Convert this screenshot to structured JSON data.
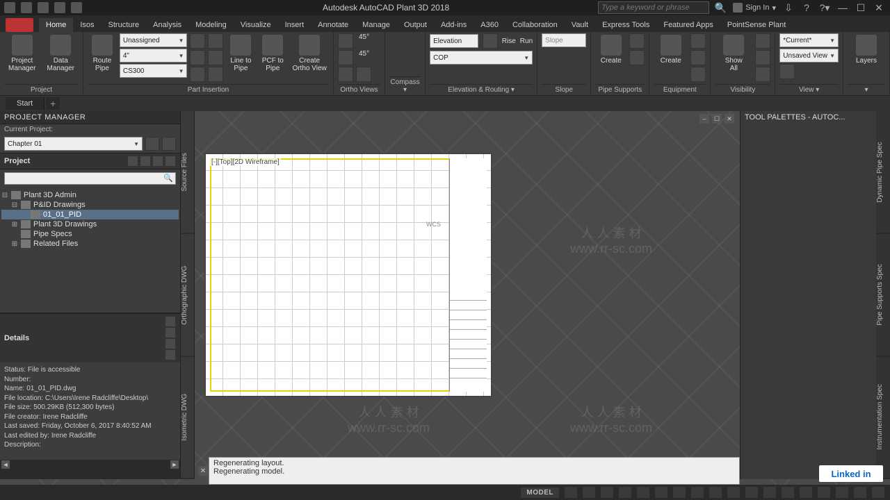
{
  "watermark": {
    "line1": "人 人 素 材",
    "line2": "www.rr-sc.com"
  },
  "titlebar": {
    "app_title": "Autodesk AutoCAD Plant 3D 2018",
    "search_placeholder": "Type a keyword or phrase",
    "sign_in": "Sign In"
  },
  "menu": {
    "tabs": [
      "Home",
      "Isos",
      "Structure",
      "Analysis",
      "Modeling",
      "Visualize",
      "Insert",
      "Annotate",
      "Manage",
      "Output",
      "Add-ins",
      "A360",
      "Collaboration",
      "Vault",
      "Express Tools",
      "Featured Apps",
      "PointSense Plant"
    ]
  },
  "ribbon": {
    "project": {
      "label": "Project",
      "project_manager": "Project\nManager",
      "data_manager": "Data\nManager"
    },
    "part_insertion": {
      "label": "Part Insertion",
      "route_pipe": "Route\nPipe",
      "assign_combo": "Unassigned",
      "size_combo": "4\"",
      "spec_combo": "CS300",
      "line_to_pipe": "Line to\nPipe",
      "pcf_to_pipe": "PCF to\nPipe",
      "create_ortho": "Create\nOrtho View"
    },
    "ortho_views": {
      "label": "Ortho Views",
      "a45": "45°"
    },
    "compass": {
      "label": "Compass ▾"
    },
    "elevation_routing": {
      "label": "Elevation & Routing ▾",
      "elevation_lbl": "Elevation",
      "cop": "COP",
      "rise": "Rise",
      "run": "Run"
    },
    "slope": {
      "label": "Slope",
      "slope_lbl": "Slope"
    },
    "pipe_supports": {
      "label": "Pipe Supports",
      "create": "Create"
    },
    "equipment": {
      "label": "Equipment",
      "create": "Create"
    },
    "visibility": {
      "label": "Visibility",
      "show_all": "Show\nAll"
    },
    "view": {
      "label": "View ▾",
      "current": "*Current*",
      "unsaved": "Unsaved View"
    },
    "layers": {
      "label": "Layers"
    }
  },
  "filetabs": {
    "start": "Start"
  },
  "pm": {
    "title": "PROJECT MANAGER",
    "current_label": "Current Project:",
    "current_value": "Chapter 01",
    "project_header": "Project",
    "tree": {
      "root": "Plant 3D Admin",
      "pid_folder": "P&ID Drawings",
      "pid_file": "01_01_PID",
      "p3d_folder": "Plant 3D Drawings",
      "pipe_specs": "Pipe Specs",
      "related": "Related Files"
    },
    "details": {
      "header": "Details",
      "status": "Status: File is accessible",
      "number": "Number:",
      "name": "Name: 01_01_PID.dwg",
      "location": "File location: C:\\Users\\Irene Radcliffe\\Desktop\\",
      "size": "File size: 500.29KB (512,300 bytes)",
      "creator": "File creator: Irene Radcliffe",
      "saved": "Last saved: Friday, October 6, 2017 8:40:52 AM",
      "edited": "Last edited by: Irene Radcliffe",
      "desc": "Description:"
    }
  },
  "vside": {
    "source": "Source Files",
    "ortho": "Orthographic DWG",
    "iso": "Isometric DWG"
  },
  "viewport": {
    "label": "[-][Top][2D Wireframe]",
    "wcs": "WCS"
  },
  "tp": {
    "title": "TOOL PALETTES - AUTOC...",
    "t1": "Dynamic Pipe Spec",
    "t2": "Pipe Supports Spec",
    "t3": "Instrumentation Spec"
  },
  "cmd": {
    "l1": "Regenerating layout.",
    "l2": "Regenerating model."
  },
  "status": {
    "model": "MODEL"
  },
  "brand": {
    "linkedin": "Linked in"
  }
}
